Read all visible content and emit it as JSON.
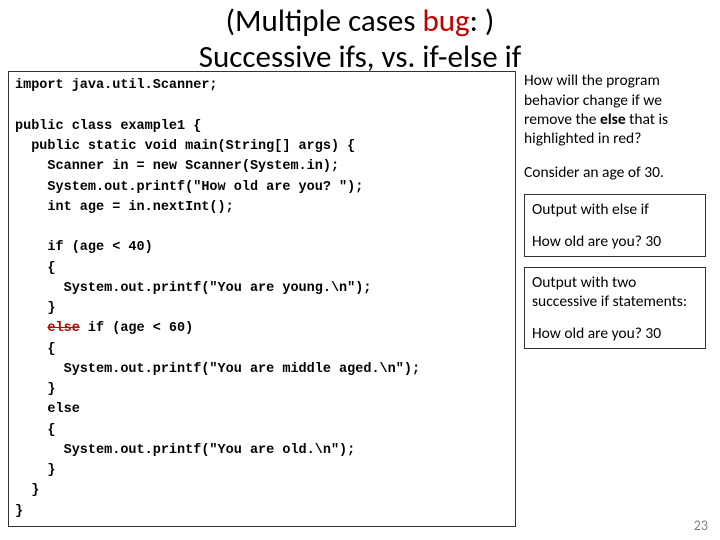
{
  "title": {
    "line1_pre": "(Multiple cases ",
    "line1_bug": "bug",
    "line1_post": ": )",
    "line2": "Successive ifs, vs. if-else if"
  },
  "code": {
    "l01": "import java.util.Scanner;",
    "l02": "",
    "l03": "public class example1 {",
    "l04": "  public static void main(String[] args) {",
    "l05": "    Scanner in = new Scanner(System.in);",
    "l06": "    System.out.printf(\"How old are you? \");",
    "l07": "    int age = in.nextInt();",
    "l08": "",
    "l09": "    if (age < 40)",
    "l10": "    {",
    "l11": "      System.out.printf(\"You are young.\\n\");",
    "l12": "    }",
    "l13a": "    ",
    "l13_strike": "else",
    "l13b": " if (age < 60)",
    "l14": "    {",
    "l15": "      System.out.printf(\"You are middle aged.\\n\");",
    "l16": "    }",
    "l17": "    else",
    "l18": "    {",
    "l19": "      System.out.printf(\"You are old.\\n\");",
    "l20": "    }",
    "l21": "  }",
    "l22": "}"
  },
  "right": {
    "q1_a": "How will the program behavior change if we remove the ",
    "q1_b": "else",
    "q1_c": " that is highlighted in red?",
    "q2": "Consider an age of 30.",
    "box1_h": "Output with else if",
    "box1_v": "How old are you? 30",
    "box2_h": "Output with two successive if statements:",
    "box2_v": "How old are you? 30"
  },
  "pagenum": "23"
}
